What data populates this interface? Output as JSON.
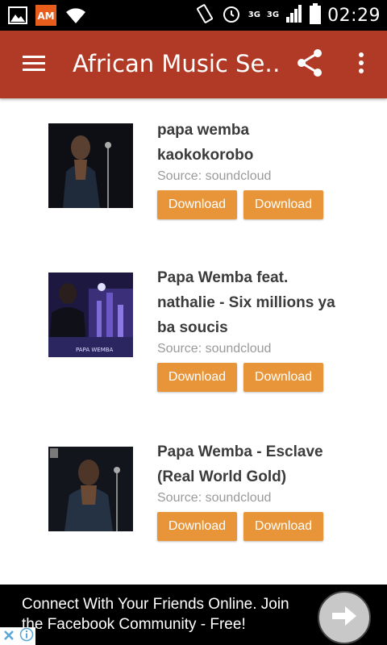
{
  "status_bar": {
    "net_a": "3G",
    "net_b": "3G",
    "time": "02:29",
    "icons": [
      "image-icon",
      "app-notification-icon",
      "wifi-icon",
      "vibrate-icon",
      "alarm-icon",
      "signal-icon",
      "battery-icon"
    ]
  },
  "app_bar": {
    "title": "African Music Se…",
    "icons": [
      "menu-icon",
      "share-icon",
      "overflow-menu-icon"
    ],
    "color": "#b03a25"
  },
  "items": [
    {
      "title_lines": [
        "papa wemba",
        "kaokokorobo"
      ],
      "source": "Source: soundcloud",
      "button_1": "Download",
      "button_2": "Download"
    },
    {
      "title_lines": [
        "Papa Wemba feat.",
        "nathalie - Six millions ya",
        "ba soucis"
      ],
      "source": "Source: soundcloud",
      "button_1": "Download",
      "button_2": "Download",
      "cover_text": "PAPA WEMBA"
    },
    {
      "title_lines": [
        "Papa Wemba - Esclave",
        "(Real World Gold)"
      ],
      "source": "Source: soundcloud",
      "button_1": "Download",
      "button_2": "Download"
    }
  ],
  "ad": {
    "line1": "Connect With Your Friends Online. Join",
    "line2": "the Facebook Community - Free!",
    "icons": [
      "close-icon",
      "info-icon",
      "arrow-right-icon"
    ]
  },
  "colors": {
    "button": "#e8953a",
    "source_text": "#9a9a9a"
  }
}
